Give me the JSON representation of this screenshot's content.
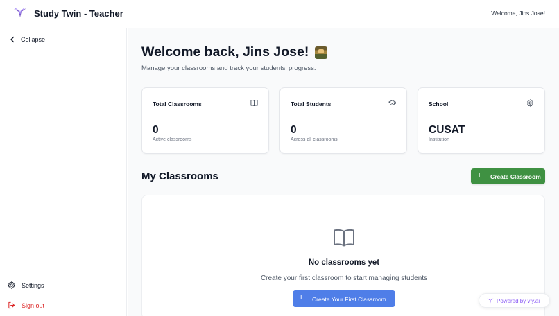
{
  "header": {
    "app_title": "Study Twin - Teacher",
    "welcome_user": "Welcome, Jins Jose!",
    "logo_icon": "v-bird-logo-icon"
  },
  "sidebar": {
    "collapse_label": "Collapse",
    "settings_label": "Settings",
    "signout_label": "Sign out"
  },
  "main": {
    "headline": "Welcome back, Jins Jose!",
    "subline": "Manage your classrooms and track your students' progress.",
    "cards": [
      {
        "title": "Total Classrooms",
        "value": "0",
        "subtitle": "Active classrooms",
        "icon": "book-open-icon"
      },
      {
        "title": "Total Students",
        "value": "0",
        "subtitle": "Across all classrooms",
        "icon": "graduation-cap-icon"
      },
      {
        "title": "School",
        "value": "CUSAT",
        "subtitle": "Institution",
        "icon": "gear-icon"
      }
    ],
    "section_title": "My Classrooms",
    "create_button_label": "Create Classroom",
    "empty": {
      "title": "No classrooms yet",
      "description": "Create your first classroom to start managing students",
      "button_label": "Create Your First Classroom"
    }
  },
  "footer": {
    "powered_by": "Powered by vly.ai"
  },
  "colors": {
    "primary_green": "#3f9142",
    "primary_blue": "#4f7ee8",
    "signout_red": "#dc2626",
    "brand_purple": "#8b5cf6"
  }
}
